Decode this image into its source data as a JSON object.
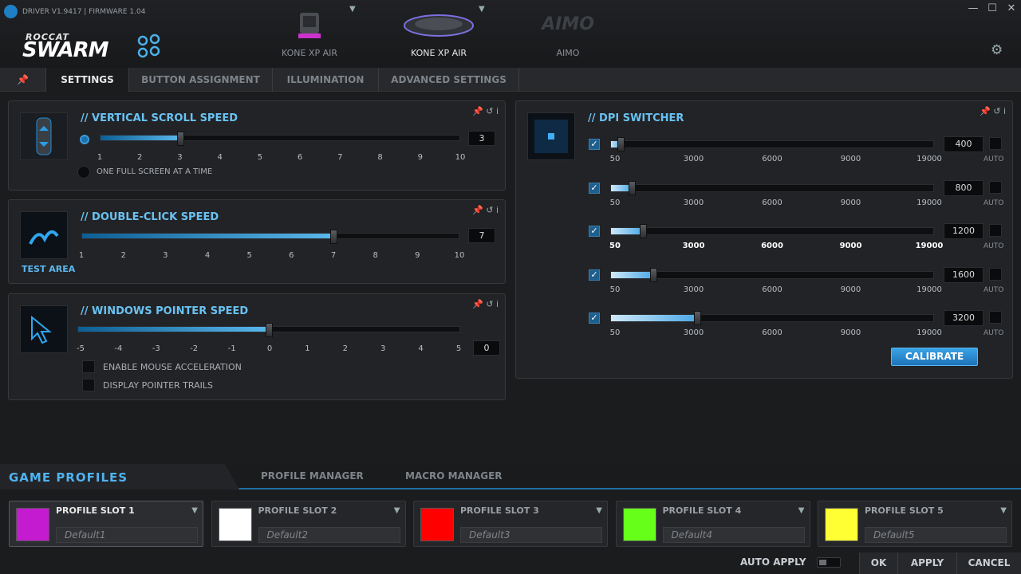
{
  "header": {
    "version": "DRIVER V1.9417 | FIRMWARE 1.04",
    "brand_small": "ROCCAT",
    "brand_big": "SWARM",
    "devices": [
      {
        "label": "KONE XP AIR"
      },
      {
        "label": "KONE XP AIR"
      },
      {
        "label": "AIMO"
      }
    ]
  },
  "tabs": [
    {
      "label": "SETTINGS"
    },
    {
      "label": "BUTTON ASSIGNMENT"
    },
    {
      "label": "ILLUMINATION"
    },
    {
      "label": "ADVANCED SETTINGS"
    }
  ],
  "scroll": {
    "title": "// VERTICAL SCROLL SPEED",
    "ticks": [
      "1",
      "2",
      "3",
      "4",
      "5",
      "6",
      "7",
      "8",
      "9",
      "10"
    ],
    "value": "3",
    "level": 3,
    "option": "ONE FULL SCREEN AT A TIME"
  },
  "dblclick": {
    "title": "// DOUBLE-CLICK SPEED",
    "test_area": "TEST AREA",
    "ticks": [
      "1",
      "2",
      "3",
      "4",
      "5",
      "6",
      "7",
      "8",
      "9",
      "10"
    ],
    "value": "7",
    "level": 7
  },
  "pointer": {
    "title": "// WINDOWS POINTER SPEED",
    "ticks": [
      "-5",
      "-4",
      "-3",
      "-2",
      "-1",
      "0",
      "1",
      "2",
      "3",
      "4",
      "5"
    ],
    "value": "0",
    "level": 0,
    "accel": "ENABLE MOUSE ACCELERATION",
    "trails": "DISPLAY POINTER TRAILS"
  },
  "dpi": {
    "title": "// DPI SWITCHER",
    "scale": [
      "50",
      "3000",
      "6000",
      "9000",
      "19000"
    ],
    "auto": "AUTO",
    "levels": [
      {
        "value": "400",
        "dpi": 400
      },
      {
        "value": "800",
        "dpi": 800
      },
      {
        "value": "1200",
        "dpi": 1200
      },
      {
        "value": "1600",
        "dpi": 1600
      },
      {
        "value": "3200",
        "dpi": 3200
      }
    ],
    "calibrate": "CALIBRATE"
  },
  "bottom": {
    "game_profiles": "GAME PROFILES",
    "profile_manager": "PROFILE MANAGER",
    "macro_manager": "MACRO MANAGER"
  },
  "slots": [
    {
      "name": "PROFILE SLOT 1",
      "value": "Default1",
      "color": "#c41ad0"
    },
    {
      "name": "PROFILE SLOT 2",
      "value": "Default2",
      "color": "#ffffff"
    },
    {
      "name": "PROFILE SLOT 3",
      "value": "Default3",
      "color": "#ff0000"
    },
    {
      "name": "PROFILE SLOT 4",
      "value": "Default4",
      "color": "#66ff1a"
    },
    {
      "name": "PROFILE SLOT 5",
      "value": "Default5",
      "color": "#ffff33"
    }
  ],
  "footer": {
    "auto_apply": "AUTO APPLY",
    "ok": "OK",
    "apply": "APPLY",
    "cancel": "CANCEL"
  }
}
